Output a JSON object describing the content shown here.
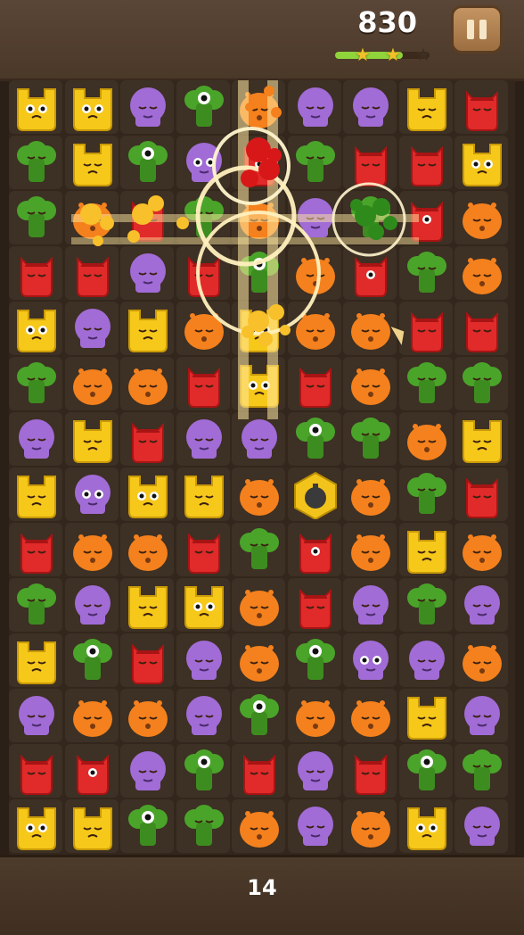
{
  "hud": {
    "score": "830",
    "progress": 0.72,
    "stars_lit": 2,
    "stars_total": 3,
    "pause_label": "pause"
  },
  "moves": "14",
  "colors": {
    "yellow": "#f6c81a",
    "purple": "#a16cd6",
    "green": "#4aa42a",
    "orange": "#f4811d",
    "red": "#e12a2a"
  },
  "board": [
    [
      "Y",
      "Y",
      "P",
      "G",
      "O",
      "P",
      "P",
      "Y",
      "R"
    ],
    [
      "G",
      "Y",
      "G",
      "P",
      "R",
      "G",
      "R",
      "R",
      "Y"
    ],
    [
      "G",
      "O",
      "R",
      "G",
      "O",
      "P",
      "G",
      "R",
      "O"
    ],
    [
      "R",
      "R",
      "P",
      "R",
      "G",
      "O",
      "R",
      "G",
      "O"
    ],
    [
      "Y",
      "P",
      "Y",
      "O",
      "Y",
      "O",
      "O",
      "R",
      "R"
    ],
    [
      "G",
      "O",
      "O",
      "R",
      "Y",
      "R",
      "O",
      "G",
      "G"
    ],
    [
      "P",
      "Y",
      "R",
      "P",
      "P",
      "G",
      "G",
      "O",
      "Y"
    ],
    [
      "Y",
      "P",
      "Y",
      "Y",
      "O",
      "B",
      "O",
      "G",
      "R"
    ],
    [
      "R",
      "O",
      "O",
      "R",
      "G",
      "R",
      "O",
      "Y",
      "O"
    ],
    [
      "G",
      "P",
      "Y",
      "Y",
      "O",
      "R",
      "P",
      "G",
      "P"
    ],
    [
      "Y",
      "G",
      "R",
      "P",
      "O",
      "G",
      "P",
      "P",
      "O"
    ],
    [
      "P",
      "O",
      "O",
      "P",
      "G",
      "O",
      "O",
      "Y",
      "P"
    ],
    [
      "R",
      "R",
      "P",
      "G",
      "R",
      "P",
      "R",
      "G",
      "G"
    ],
    [
      "Y",
      "Y",
      "G",
      "G",
      "O",
      "P",
      "O",
      "Y",
      "P"
    ]
  ]
}
